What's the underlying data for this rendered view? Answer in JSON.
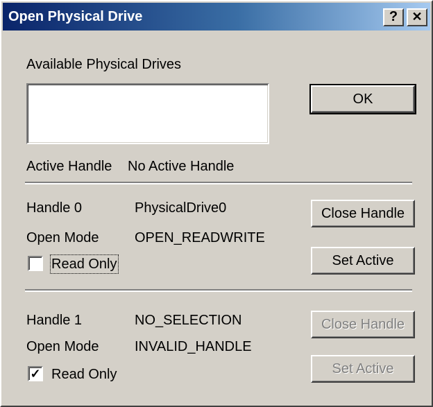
{
  "window": {
    "title": "Open Physical Drive",
    "help_glyph": "?",
    "close_glyph": "✕"
  },
  "drives": {
    "label": "Available Physical Drives",
    "items": []
  },
  "ok_button": "OK",
  "active": {
    "label": "Active Handle",
    "value": "No Active Handle"
  },
  "handle0": {
    "label": "Handle 0",
    "drive": "PhysicalDrive0",
    "mode_label": "Open Mode",
    "mode_value": "OPEN_READWRITE",
    "readonly_label": "Read Only",
    "readonly_checked": false,
    "close_button": "Close Handle",
    "set_active_button": "Set Active"
  },
  "handle1": {
    "label": "Handle 1",
    "drive": "NO_SELECTION",
    "mode_label": "Open Mode",
    "mode_value": "INVALID_HANDLE",
    "readonly_label": "Read Only",
    "readonly_checked": true,
    "close_button": "Close Handle",
    "set_active_button": "Set Active"
  }
}
